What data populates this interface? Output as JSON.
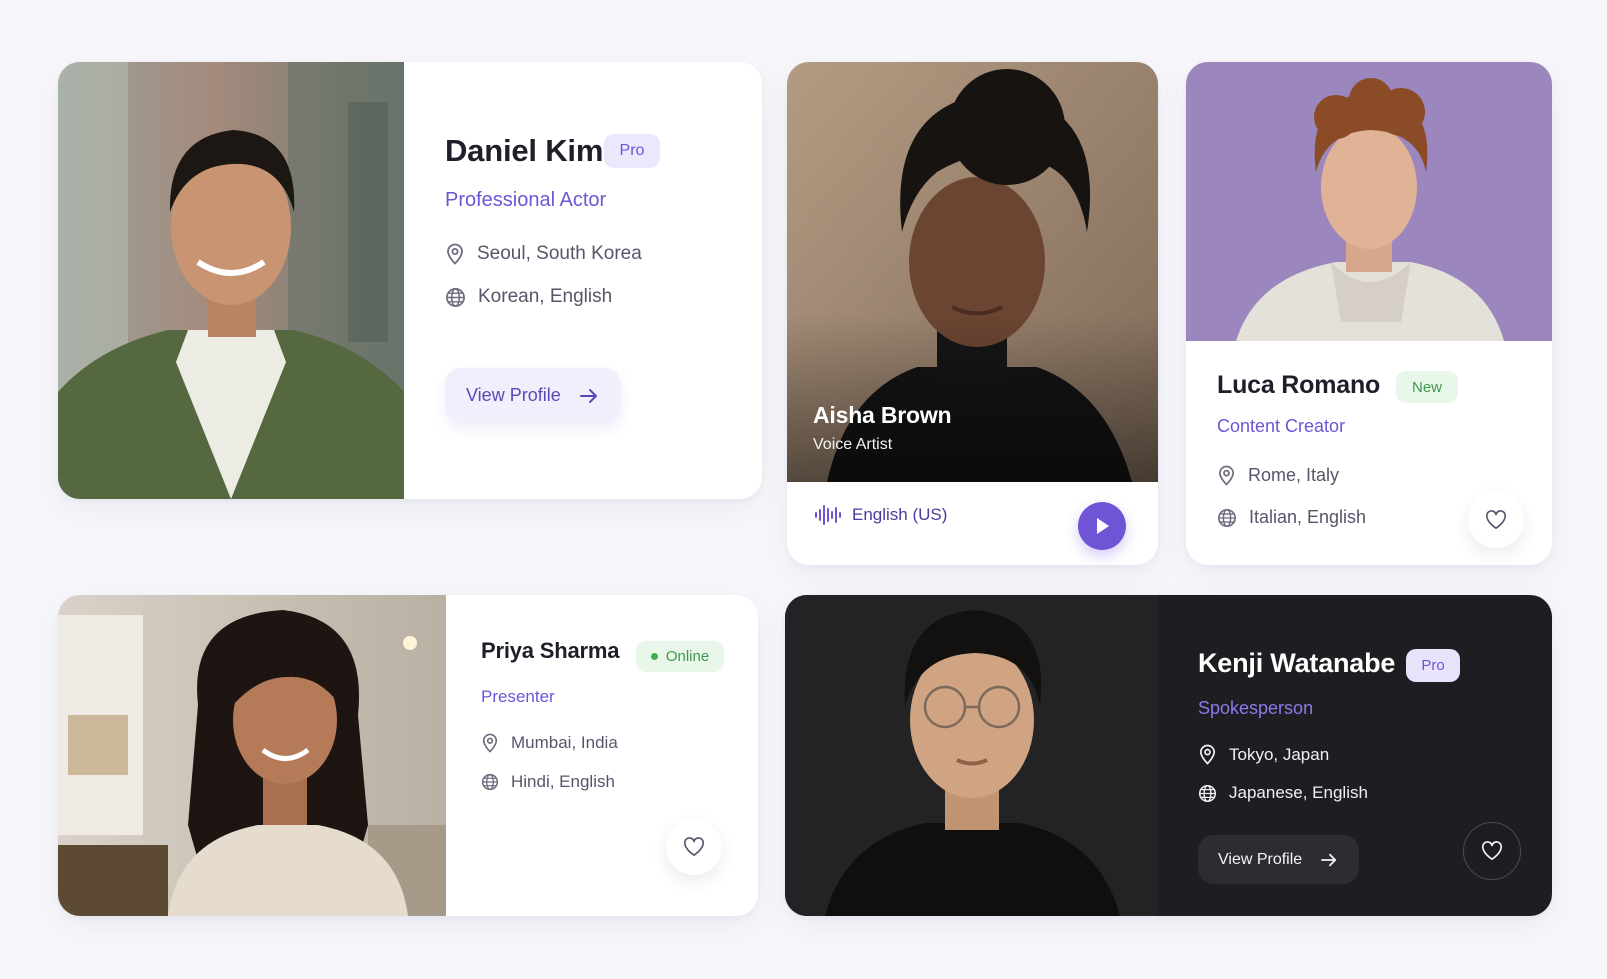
{
  "colors": {
    "accent": "#6f55d6",
    "dark_card": "#1d1e22",
    "online": "#3fae4f"
  },
  "cards": {
    "daniel": {
      "name": "Daniel Kim",
      "badge": "Pro",
      "role": "Professional Actor",
      "location": "Seoul, South Korea",
      "languages": "Korean, English",
      "button_label": "View Profile",
      "icons": [
        "location-pin-icon",
        "globe-icon",
        "arrow-right-icon"
      ]
    },
    "aisha": {
      "name": "Aisha Brown",
      "role": "Voice Artist",
      "accent_label": "English (US)",
      "icons": [
        "audio-wave-icon",
        "play-icon"
      ]
    },
    "luca": {
      "name": "Luca Romano",
      "badge": "New",
      "role": "Content Creator",
      "location": "Rome, Italy",
      "languages": "Italian, English",
      "icons": [
        "location-pin-icon",
        "globe-icon",
        "heart-icon"
      ]
    },
    "priya": {
      "name": "Priya Sharma",
      "badge": "Online",
      "role": "Presenter",
      "location": "Mumbai, India",
      "languages": "Hindi, English",
      "icons": [
        "location-pin-icon",
        "globe-icon",
        "heart-icon"
      ]
    },
    "kenji": {
      "name": "Kenji Watanabe",
      "badge": "Pro",
      "role": "Spokesperson",
      "location": "Tokyo, Japan",
      "languages": "Japanese, English",
      "button_label": "View Profile",
      "icons": [
        "location-pin-icon",
        "globe-icon",
        "arrow-right-icon",
        "heart-icon"
      ]
    }
  }
}
